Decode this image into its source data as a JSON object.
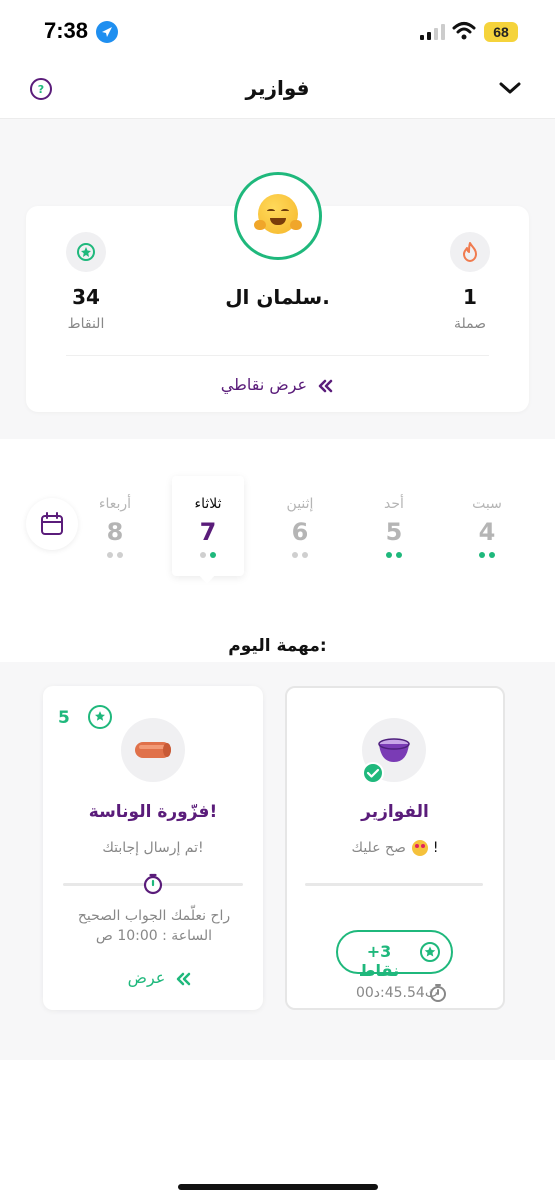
{
  "status_bar": {
    "time": "7:38",
    "battery": "68"
  },
  "header": {
    "title": "فوازير"
  },
  "profile": {
    "name": "سلمان ال.",
    "points": {
      "value": "34",
      "label": "النقاط"
    },
    "streak": {
      "value": "1",
      "label": "صملة"
    },
    "view_points_label": "عرض نقاطي"
  },
  "days": [
    {
      "name": "سبت",
      "num": "4"
    },
    {
      "name": "أحد",
      "num": "5"
    },
    {
      "name": "إثنين",
      "num": "6"
    },
    {
      "name": "ثلاثاء",
      "num": "7"
    },
    {
      "name": "أربعاء",
      "num": "8"
    }
  ],
  "today": {
    "title": "مهمة اليوم:"
  },
  "tasks": {
    "fawazir": {
      "title": "الفوازير",
      "subtitle": "صح عليك",
      "points_label": "+3  نقاط",
      "timer": "ث45.54:د00"
    },
    "nasa": {
      "title": "فزّورة الوناسة!",
      "subtitle": "تم إرسال إجابتك!",
      "reveal_line1": "راح نعلّمك الجواب الصحيح",
      "reveal_line2": "الساعة : 10:00 ص",
      "reward": "5",
      "view_label": "عرض"
    }
  },
  "colors": {
    "purple": "#5a1c7a",
    "green": "#1fb87c"
  }
}
